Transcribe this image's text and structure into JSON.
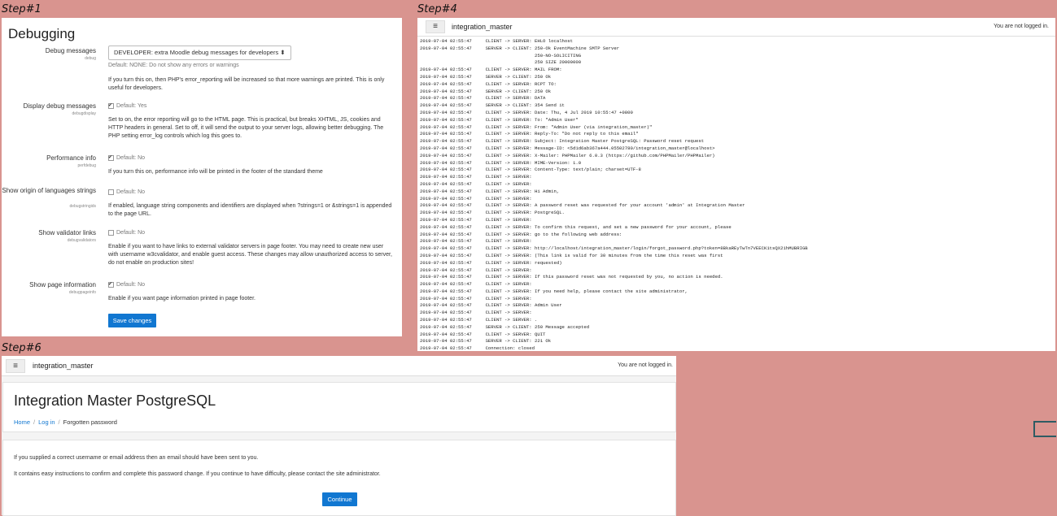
{
  "steps": {
    "s1": "Step#1",
    "s4": "Step#4",
    "s6": "Step#6"
  },
  "debugging": {
    "title": "Debugging",
    "settings": [
      {
        "title": "Debug messages",
        "key": "debug",
        "select": "DEVELOPER: extra Moodle debug messages for developers",
        "select_arrow": "⬍",
        "default": "Default: NONE: Do not show any errors or warnings",
        "desc": "If you turn this on, then PHP's error_reporting will be increased so that more warnings are printed. This is only useful for developers."
      },
      {
        "title": "Display debug messages",
        "key": "debugdisplay",
        "default": "Default: Yes",
        "desc": "Set to on, the error reporting will go to the HTML page. This is practical, but breaks XHTML, JS, cookies and HTTP headers in general. Set to off, it will send the output to your server logs, allowing better debugging. The PHP setting error_log controls which log this goes to."
      },
      {
        "title": "Performance info",
        "key": "perfdebug",
        "default": "Default: No",
        "desc": "If you turn this on, performance info will be printed in the footer of the standard theme"
      },
      {
        "title": "Show origin of languages strings",
        "key": "debugstringids",
        "default": "Default: No",
        "desc": "If enabled, language string components and identifiers are displayed when ?strings=1 or &strings=1 is appended to the page URL."
      },
      {
        "title": "Show validator links",
        "key": "debugvalidators",
        "default": "Default: No",
        "desc": "Enable if you want to have links to external validator servers in page footer. You may need to create new user with username w3cvalidator, and enable guest access. These changes may allow unauthorized access to server, do not enable on production sites!"
      },
      {
        "title": "Show page information",
        "key": "debugpageinfo",
        "default": "Default: No",
        "desc": "Enable if you want page information printed in page footer."
      }
    ],
    "save_label": "Save changes"
  },
  "mail_log": {
    "site_name": "integration_master",
    "menu_icon": "≡",
    "not_logged": "You are not logged in.",
    "lines": [
      "2019-07-04 02:55:47     CLIENT -> SERVER: EHLO localhost",
      "2019-07-04 02:55:47     SERVER -> CLIENT: 250-Ok EventMachine SMTP Server",
      "                                          250-NO-SOLICITING",
      "                                          250 SIZE 20000000",
      "2019-07-04 02:55:47     CLIENT -> SERVER: MAIL FROM:",
      "2019-07-04 02:55:47     SERVER -> CLIENT: 250 Ok",
      "2019-07-04 02:55:47     CLIENT -> SERVER: RCPT TO:",
      "2019-07-04 02:55:47     SERVER -> CLIENT: 250 Ok",
      "2019-07-04 02:55:47     CLIENT -> SERVER: DATA",
      "2019-07-04 02:55:47     SERVER -> CLIENT: 354 Send it",
      "2019-07-04 02:55:47     CLIENT -> SERVER: Date: Thu, 4 Jul 2019 10:55:47 +0800",
      "2019-07-04 02:55:47     CLIENT -> SERVER: To: \"Admin User\"",
      "2019-07-04 02:55:47     CLIENT -> SERVER: From: \"Admin User (via integration_master)\"",
      "2019-07-04 02:55:47     CLIENT -> SERVER: Reply-To: \"Do not reply to this email\"",
      "2019-07-04 02:55:47     CLIENT -> SERVER: Subject: Integration Master PostgreSQL: Password reset request",
      "2019-07-04 02:55:47     CLIENT -> SERVER: Message-ID: <5d1d6ab367a444.05502780/integration_master@localhost>",
      "2019-07-04 02:55:47     CLIENT -> SERVER: X-Mailer: PHPMailer 6.0.3 (https://github.com/PHPMailer/PHPMailer)",
      "2019-07-04 02:55:47     CLIENT -> SERVER: MIME-Version: 1.0",
      "2019-07-04 02:55:47     CLIENT -> SERVER: Content-Type: text/plain; charset=UTF-8",
      "2019-07-04 02:55:47     CLIENT -> SERVER:",
      "2019-07-04 02:55:47     CLIENT -> SERVER:",
      "2019-07-04 02:55:47     CLIENT -> SERVER: Hi Admin,",
      "2019-07-04 02:55:47     CLIENT -> SERVER:",
      "2019-07-04 02:55:47     CLIENT -> SERVER: A password reset was requested for your account 'admin' at Integration Master",
      "2019-07-04 02:55:47     CLIENT -> SERVER: PostgreSQL.",
      "2019-07-04 02:55:47     CLIENT -> SERVER:",
      "2019-07-04 02:55:47     CLIENT -> SERVER: To confirm this request, and set a new password for your account, please",
      "2019-07-04 02:55:47     CLIENT -> SERVER: go to the following web address:",
      "2019-07-04 02:55:47     CLIENT -> SERVER:",
      "2019-07-04 02:55:47     CLIENT -> SERVER: http://localhost/integration_master/login/forgot_password.php?token=8BkaREyTwTn7VEECK1tsQX21hMUBRIGB",
      "2019-07-04 02:55:47     CLIENT -> SERVER: (This link is valid for 30 minutes from the time this reset was first",
      "2019-07-04 02:55:47     CLIENT -> SERVER: requested)",
      "2019-07-04 02:55:47     CLIENT -> SERVER:",
      "2019-07-04 02:55:47     CLIENT -> SERVER: If this password reset was not requested by you, no action is needed.",
      "2019-07-04 02:55:47     CLIENT -> SERVER:",
      "2019-07-04 02:55:47     CLIENT -> SERVER: If you need help, please contact the site administrator,",
      "2019-07-04 02:55:47     CLIENT -> SERVER:",
      "2019-07-04 02:55:47     CLIENT -> SERVER: Admin User",
      "2019-07-04 02:55:47     CLIENT -> SERVER:",
      "2019-07-04 02:55:47     CLIENT -> SERVER: .",
      "2019-07-04 02:55:47     SERVER -> CLIENT: 250 Message accepted",
      "2019-07-04 02:55:47     CLIENT -> SERVER: QUIT",
      "2019-07-04 02:55:47     SERVER -> CLIENT: 221 Ok",
      "2019-07-04 02:55:47     Connection: closed"
    ]
  },
  "forgot": {
    "site_name": "integration_master",
    "menu_icon": "≡",
    "not_logged": "You are not logged in.",
    "heading": "Integration Master PostgreSQL",
    "crumb_home": "Home",
    "crumb_login": "Log in",
    "crumb_current": "Forgotten password",
    "crumb_sep": "/",
    "msg1": "If you supplied a correct username or email address then an email should have been sent to you.",
    "msg2": "It contains easy instructions to confirm and complete this password change. If you continue to have difficulty, please contact the site administrator.",
    "continue_label": "Continue"
  }
}
